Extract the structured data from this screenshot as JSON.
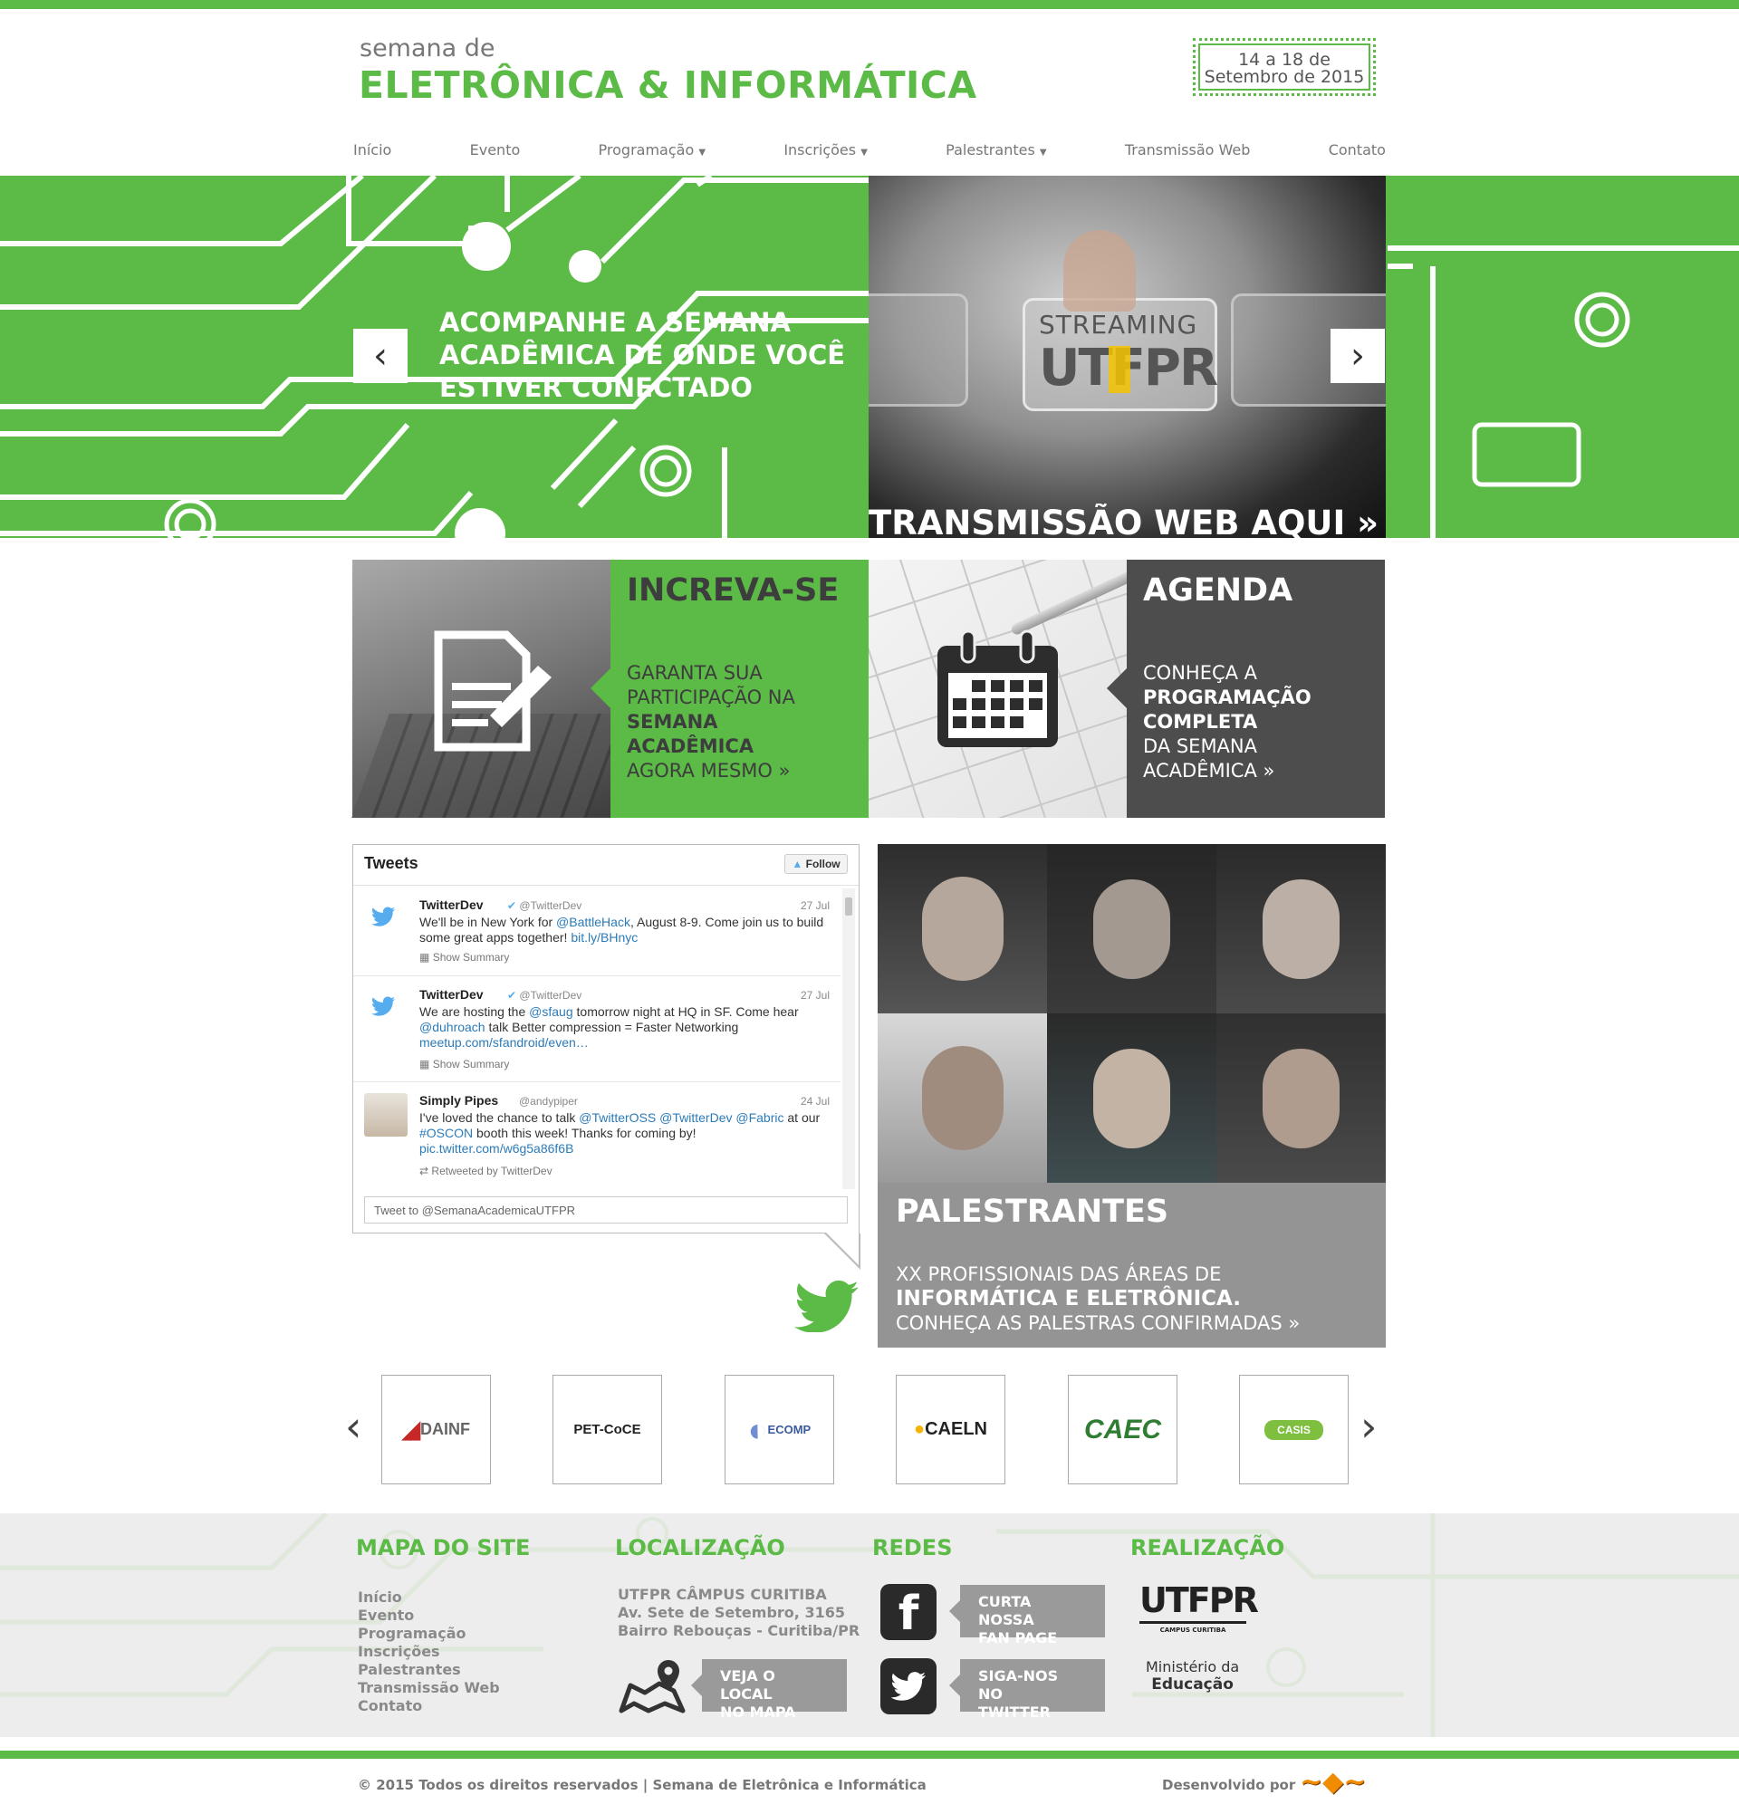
{
  "header": {
    "brand_small": "semana de",
    "brand_big": "ELETRÔNICA & INFORMÁTICA",
    "date_line1": "14 a 18 de",
    "date_line2": "Setembro de 2015"
  },
  "nav": {
    "items": [
      {
        "label": "Início",
        "dropdown": false
      },
      {
        "label": "Evento",
        "dropdown": false
      },
      {
        "label": "Programação",
        "dropdown": true
      },
      {
        "label": "Inscrições",
        "dropdown": true
      },
      {
        "label": "Palestrantes",
        "dropdown": true
      },
      {
        "label": "Transmissão Web",
        "dropdown": false
      },
      {
        "label": "Contato",
        "dropdown": false
      }
    ]
  },
  "hero": {
    "headline": "ACOMPANHE A SEMANA ACADÊMICA DE ONDE VOCÊ ESTIVER CONECTADO",
    "streaming_label": "STREAMING",
    "logo_text": "UTFPR",
    "banner_text": "TRANSMISSÃO WEB AQUI",
    "prev_icon": "chevron-left-icon",
    "next_icon": "chevron-right-icon"
  },
  "tiles": {
    "inscreva": {
      "title": "INCREVA-SE",
      "line1": "GARANTA SUA",
      "line2": "PARTICIPAÇÃO NA",
      "line3": "SEMANA",
      "line4": "ACADÊMICA",
      "line5": "AGORA MESMO",
      "icon": "document-edit-icon"
    },
    "agenda": {
      "title": "AGENDA",
      "line1": "CONHEÇA A",
      "line2": "PROGRAMAÇÃO",
      "line3": "COMPLETA",
      "line4": "DA SEMANA",
      "line5": "ACADÊMICA",
      "icon": "calendar-icon"
    }
  },
  "tweets": {
    "header": "Tweets",
    "follow_label": "Follow",
    "items": [
      {
        "name": "TwitterDev",
        "handle": "@TwitterDev",
        "date": "27 Jul",
        "body_pre": "We'll be in New York for ",
        "mention": "@BattleHack",
        "body_post": ", August 8-9. Come join us to build some great apps together! ",
        "link": "bit.ly/BHnyc",
        "summary": "Show Summary"
      },
      {
        "name": "TwitterDev",
        "handle": "@TwitterDev",
        "date": "27 Jul",
        "body_pre": "We are hosting the ",
        "mention": "@sfaug",
        "body_post": " tomorrow night at HQ in SF. Come hear ",
        "mention2": "@duhroach",
        "body_post2": " talk Better compression = Faster Networking",
        "link": "meetup.com/sfandroid/even…",
        "summary": "Show Summary"
      },
      {
        "name": "Simply Pipes",
        "handle": "@andypiper",
        "date": "24 Jul",
        "body_pre": "I've loved the chance to talk ",
        "mention": "@TwitterOSS",
        "mention2": "@TwitterDev",
        "mention3": "@Fabric",
        "body_mid": " at our ",
        "hashtag": "#OSCON",
        "body_post": " booth this week! Thanks for coming by!",
        "link": "pic.twitter.com/w6g5a86f6B",
        "summary": "Retweeted by TwitterDev"
      }
    ],
    "input_placeholder": "Tweet to @SemanaAcademicaUTFPR"
  },
  "speakers": {
    "title": "PALESTRANTES",
    "line1": "XX PROFISSIONAIS DAS ÁREAS DE",
    "line2": "INFORMÁTICA E ELETRÔNICA.",
    "line3": "CONHEÇA AS PALESTRAS CONFIRMADAS"
  },
  "partners": {
    "logos": [
      "DAINF",
      "PET-CoCE",
      "ECOMP",
      "CAELN",
      "CAEC",
      "CASIS"
    ]
  },
  "footer": {
    "sitemap_title": "MAPA DO SITE",
    "sitemap": [
      "Início",
      "Evento",
      "Programação",
      "Inscrições",
      "Palestrantes",
      "Transmissão Web",
      "Contato"
    ],
    "location_title": "LOCALIZAÇÃO",
    "address1": "UTFPR CÂMPUS CURITIBA",
    "address2": "Av. Sete de Setembro, 3165",
    "address3": "Bairro Rebouças - Curitiba/PR",
    "map_line1": "VEJA O LOCAL",
    "map_line2": "NO MAPA",
    "networks_title": "REDES",
    "fb_line1": "CURTA NOSSA",
    "fb_line2": "FAN PAGE",
    "tw_line1": "SIGA-NOS NO",
    "tw_line2": "TWITTER",
    "realization_title": "REALIZAÇÃO",
    "utfpr_logo": "UTFPR",
    "utfpr_sub": "CAMPUS CURITIBA",
    "ministry_line1": "Ministério da",
    "ministry_line2": "Educação"
  },
  "bottom": {
    "copyright": "© 2015 Todos os direitos reservados | Semana de Eletrônica e Informática",
    "developed_by": "Desenvolvido por"
  },
  "colors": {
    "accent": "#5cba47",
    "dark_panel": "#4d4d4d",
    "speaker_panel": "#949494"
  }
}
